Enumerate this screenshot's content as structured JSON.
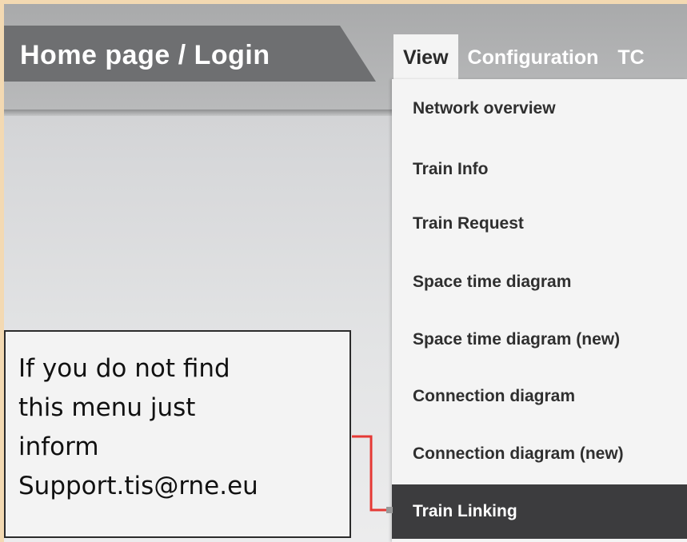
{
  "breadcrumb": {
    "title": "Home page / Login"
  },
  "menubar": {
    "tabs": [
      {
        "label": "View",
        "active": true
      },
      {
        "label": "Configuration",
        "active": false
      },
      {
        "label": "TC",
        "active": false
      }
    ]
  },
  "dropdown": {
    "items": [
      {
        "label": "Network overview"
      },
      {
        "label": "Train Info"
      },
      {
        "label": "Train Request"
      },
      {
        "label": "Space time diagram"
      },
      {
        "label": "Space time diagram (new)"
      },
      {
        "label": "Connection diagram"
      },
      {
        "label": "Connection diagram (new)"
      },
      {
        "label": "Train Linking",
        "highlighted": true
      }
    ]
  },
  "callout": {
    "lines": [
      "If you do not find",
      "this menu just",
      "inform",
      "Support.tis@rne.eu"
    ]
  },
  "colors": {
    "frame": "#f3d9b2",
    "breadcrumb_bg": "#6e6f71",
    "highlight_bg": "#3c3c3e",
    "connector": "#e53935"
  }
}
